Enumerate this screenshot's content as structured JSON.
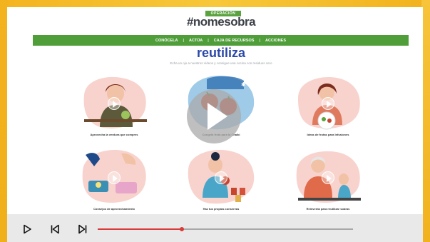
{
  "site": {
    "tag": "OPERACIÓN",
    "logo": "#nomesobra",
    "nav": [
      "CONÓCELA",
      "ACTÚA",
      "CAJA DE RECURSOS",
      "ACCIONES"
    ],
    "nav_separator": "|",
    "title": "reutiliza",
    "subtitle": "Echa un ojo a nuestros vídeos y consigue una cocina con residuos cero"
  },
  "cards": [
    {
      "caption": "Aprovecha la verdura que compres",
      "icon": "woman-cooking-illustration",
      "accent": "#f7c9c4"
    },
    {
      "caption": "Congela fruta para la Chaiki",
      "icon": "frozen-fruit-illustration",
      "accent": "#8cc1e6"
    },
    {
      "caption": "Ideas de frutas para Infusiones",
      "icon": "woman-smoothie-illustration",
      "accent": "#f7c9c4"
    },
    {
      "caption": "Consejos de aprovechamiento",
      "icon": "hands-cooking-illustration",
      "accent": "#f7c9c4"
    },
    {
      "caption": "Haz tus propias conservas",
      "icon": "woman-preserves-illustration",
      "accent": "#f7c9c4"
    },
    {
      "caption": "Reinventa para reutilizar sobras",
      "icon": "family-cooking-illustration",
      "accent": "#f7c9c4"
    }
  ],
  "player": {
    "progress_fraction": 0.33,
    "colors": {
      "progress": "#d93a3a",
      "track": "#a8a8a8",
      "bar": "#e9e9e9"
    },
    "buttons": [
      "play-icon",
      "skip-back-icon",
      "skip-forward-icon"
    ]
  },
  "colors": {
    "brand_green": "#4f9e3a",
    "title_blue": "#2a48a8",
    "frame": "#f6c02a"
  }
}
